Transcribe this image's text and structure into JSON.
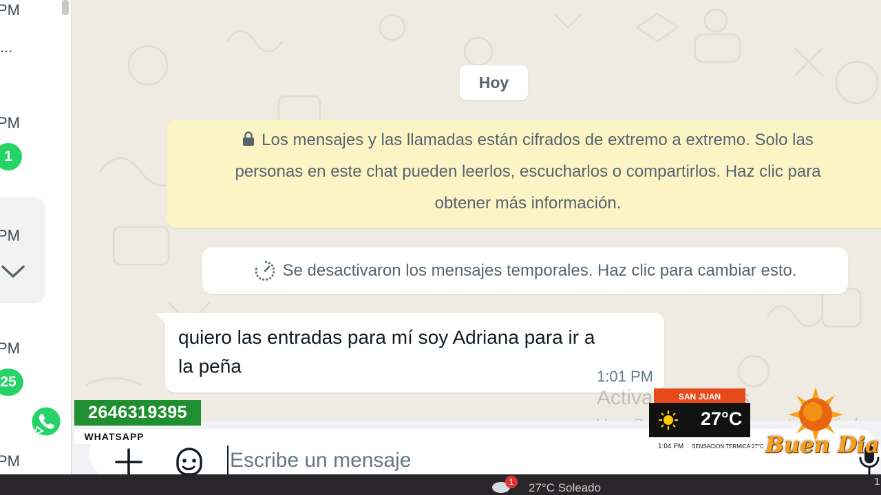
{
  "sidebar": {
    "times": [
      "PM",
      "PM",
      "PM",
      "PM",
      "PM"
    ],
    "preview_ellipsis": "...",
    "badges": [
      "1",
      "25"
    ]
  },
  "conversation": {
    "date_chip": "Hoy",
    "encryption_notice": {
      "icon": "lock-icon",
      "lines": [
        "Los mensajes y las llamadas están cifrados de extremo a extremo. Solo las",
        "personas en este chat pueden leerlos, escucharlos o compartirlos. Haz clic para",
        "obtener más información."
      ]
    },
    "ephemeral_notice": {
      "icon": "timer-icon",
      "text": "Se desactivaron los mensajes temporales. Haz clic para cambiar esto."
    },
    "messages": [
      {
        "direction": "incoming",
        "lines": [
          "quiero las entradas para mí soy Adriana para ir a",
          "la peña"
        ],
        "time": "1:01 PM"
      }
    ]
  },
  "composer": {
    "placeholder": "Escribe un mensaje",
    "value": "",
    "attach_icon": "plus-icon",
    "sticker_icon": "sticker-icon",
    "mic_icon": "mic-icon"
  },
  "windows_watermark": {
    "title": "Activar Windows",
    "subtitle": "Ve a Configuración para activar Windows."
  },
  "taskbar": {
    "notification_count": "1",
    "text": "27°C  Soleado",
    "right": "1"
  },
  "tv_overlay": {
    "whatsapp": {
      "phone": "2646319395",
      "label": "WHATSAPP"
    },
    "weather": {
      "city": "SAN JUAN",
      "temperature": "27°C",
      "time": "1:04 PM",
      "feels_like_label": "SENSACION TERMICA",
      "feels_like_value": "27°C"
    },
    "greeting": "Buen Dia"
  },
  "colors": {
    "wallpaper": "#efeae2",
    "notice_yellow": "#fdf4c5",
    "unread_badge": "#25d366",
    "whatsapp_green": "#1f8f2f",
    "weather_orange": "#e64a19"
  }
}
